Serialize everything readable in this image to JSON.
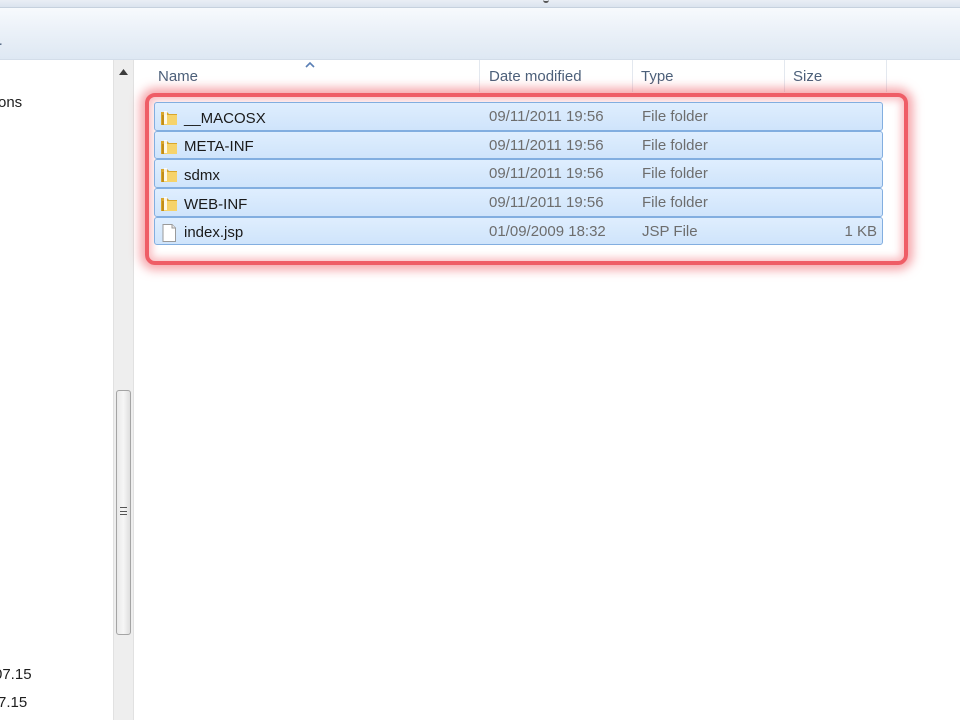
{
  "window": {
    "title_fragment": "",
    "toolbar_fragment": "r"
  },
  "nav": {
    "items": [
      {
        "label": "ons"
      },
      {
        "label": "07.15"
      },
      {
        "label": "7.15"
      }
    ]
  },
  "list": {
    "columns": [
      "Name",
      "Date modified",
      "Type",
      "Size"
    ],
    "sort_column": "Name",
    "sort_direction": "ascending",
    "rows": [
      {
        "name": "__MACOSX",
        "date": "09/11/2011 19:56",
        "type": "File folder",
        "size": "",
        "icon": "folder-icon"
      },
      {
        "name": "META-INF",
        "date": "09/11/2011 19:56",
        "type": "File folder",
        "size": "",
        "icon": "folder-icon"
      },
      {
        "name": "sdmx",
        "date": "09/11/2011 19:56",
        "type": "File folder",
        "size": "",
        "icon": "folder-icon"
      },
      {
        "name": "WEB-INF",
        "date": "09/11/2011 19:56",
        "type": "File folder",
        "size": "",
        "icon": "folder-icon"
      },
      {
        "name": "index.jsp",
        "date": "01/09/2009 18:32",
        "type": "JSP File",
        "size": "1 KB",
        "icon": "file-icon"
      }
    ]
  },
  "colors": {
    "selection_bg": "#cfe4fb",
    "selection_border": "#82aee0",
    "highlight_ring": "#ef5d66",
    "header_text": "#4c607a",
    "detail_text": "#6d6d6d"
  }
}
